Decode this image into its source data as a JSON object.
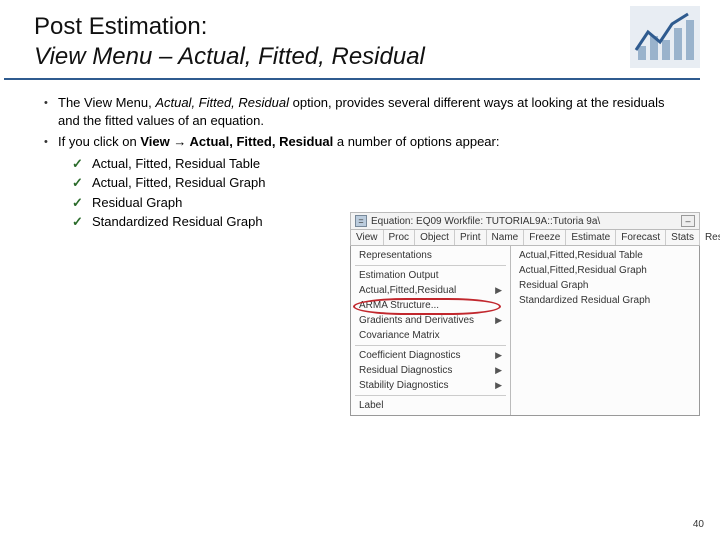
{
  "title": {
    "line1": "Post Estimation:",
    "line2": "View Menu – Actual, Fitted, Residual"
  },
  "bullets": {
    "b1_pre": "The View Menu, ",
    "b1_em": "Actual, Fitted, Residual",
    "b1_post": " option, provides several different ways at looking at the residuals and the fitted values of an equation.",
    "b2_pre": "If you click on ",
    "b2_strong": "View → Actual, Fitted, Residual",
    "b2_post": " a number of options appear:"
  },
  "checks": [
    "Actual, Fitted, Residual Table",
    "Actual, Fitted, Residual Graph",
    "Residual Graph",
    "Standardized Residual Graph"
  ],
  "figure": {
    "winTitle": "Equation: EQ09   Workfile: TUTORIAL9A::Tutoria 9a\\",
    "toolbar": [
      "View",
      "Proc",
      "Object",
      "Print",
      "Name",
      "Freeze",
      "Estimate",
      "Forecast",
      "Stats",
      "Resids"
    ],
    "leftMenu": [
      {
        "label": "Representations",
        "arrow": false,
        "sepAfter": true
      },
      {
        "label": "Estimation Output",
        "arrow": false
      },
      {
        "label": "Actual,Fitted,Residual",
        "arrow": true
      },
      {
        "label": "ARMA Structure...",
        "arrow": false
      },
      {
        "label": "Gradients and Derivatives",
        "arrow": true
      },
      {
        "label": "Covariance Matrix",
        "arrow": false,
        "sepAfter": true
      },
      {
        "label": "Coefficient Diagnostics",
        "arrow": true
      },
      {
        "label": "Residual Diagnostics",
        "arrow": true
      },
      {
        "label": "Stability Diagnostics",
        "arrow": true,
        "sepAfter": true
      },
      {
        "label": "Label",
        "arrow": false
      }
    ],
    "rightMenu": [
      "Actual,Fitted,Residual Table",
      "Actual,Fitted,Residual Graph",
      "Residual Graph",
      "Standardized Residual Graph"
    ]
  },
  "pageNumber": "40"
}
